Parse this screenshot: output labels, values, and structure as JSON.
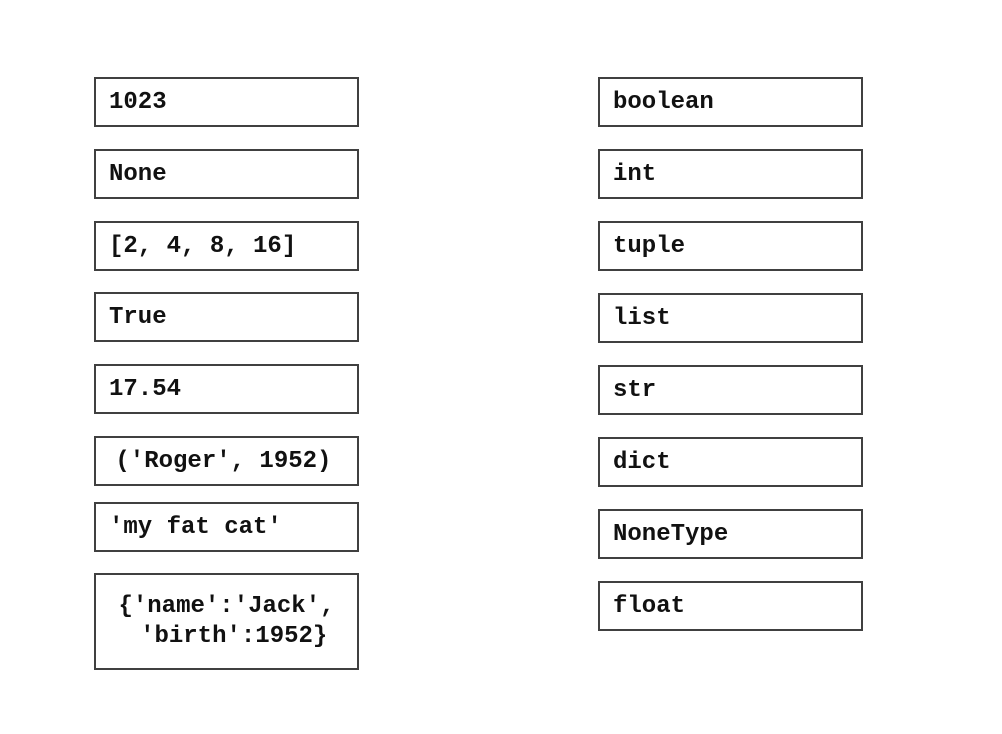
{
  "values": [
    {
      "text": "1023"
    },
    {
      "text": "None"
    },
    {
      "text": "[2, 4, 8, 16]"
    },
    {
      "text": "True"
    },
    {
      "text": "17.54"
    },
    {
      "text": " ('Roger', 1952)"
    },
    {
      "text": "'my fat cat'"
    },
    {
      "lines": [
        "{'name':'Jack',",
        " 'birth':1952}"
      ]
    }
  ],
  "types": [
    {
      "text": "boolean"
    },
    {
      "text": "int"
    },
    {
      "text": "tuple"
    },
    {
      "text": "list"
    },
    {
      "text": "str"
    },
    {
      "text": "dict"
    },
    {
      "text": "NoneType"
    },
    {
      "text": "float"
    }
  ]
}
